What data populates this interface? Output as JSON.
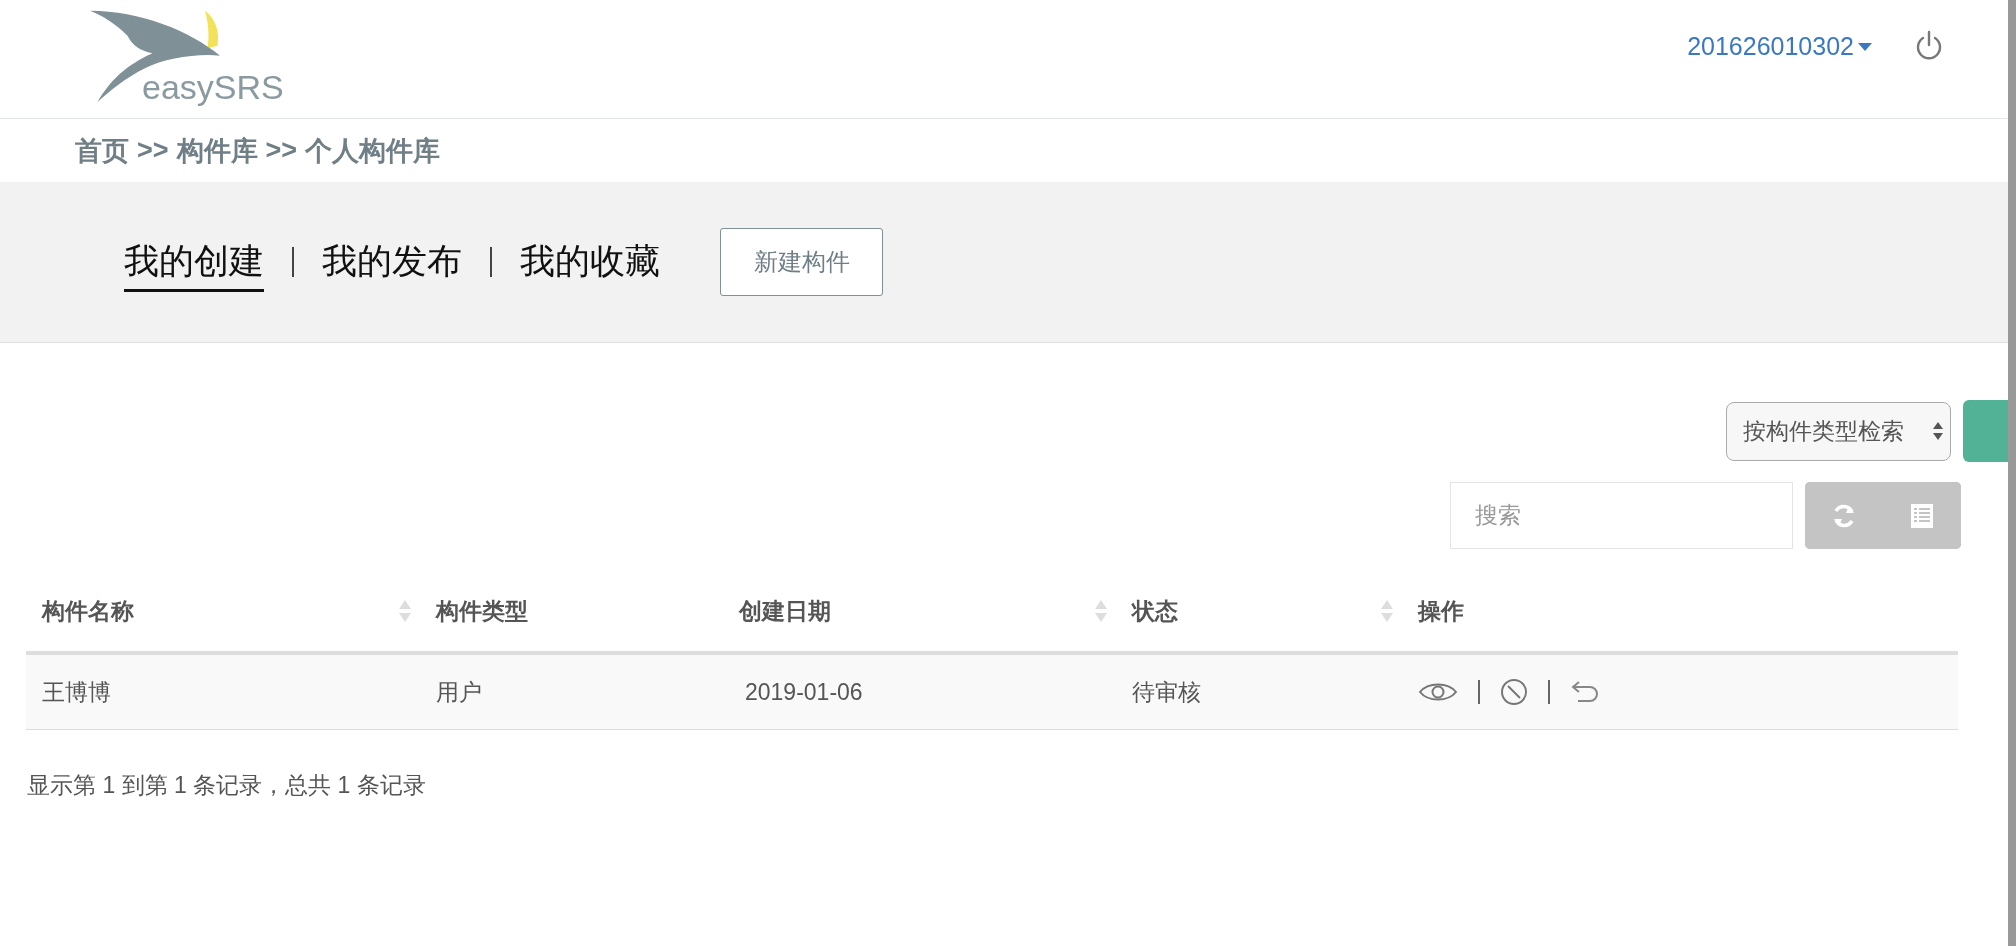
{
  "header": {
    "logo_text": "easySRS",
    "user": "201626010302"
  },
  "breadcrumb": [
    "首页",
    ">>",
    "构件库",
    ">>",
    "个人构件库"
  ],
  "tabs": [
    {
      "label": "我的创建",
      "selected": true
    },
    {
      "label": "我的发布",
      "selected": false
    },
    {
      "label": "我的收藏",
      "selected": false
    }
  ],
  "new_button": "新建构件",
  "filter_select": "按构件类型检索",
  "search": {
    "placeholder": "搜索"
  },
  "table": {
    "columns": [
      {
        "label": "构件名称",
        "sortable": true
      },
      {
        "label": "构件类型",
        "sortable": false
      },
      {
        "label": "创建日期",
        "sortable": true
      },
      {
        "label": "状态",
        "sortable": true
      },
      {
        "label": "操作",
        "sortable": false
      }
    ],
    "rows": [
      {
        "name": "王博博",
        "type": "用户",
        "date": "2019-01-06",
        "status": "待审核"
      }
    ]
  },
  "pagination_info": "显示第 1 到第 1 条记录，总共 1 条记录"
}
